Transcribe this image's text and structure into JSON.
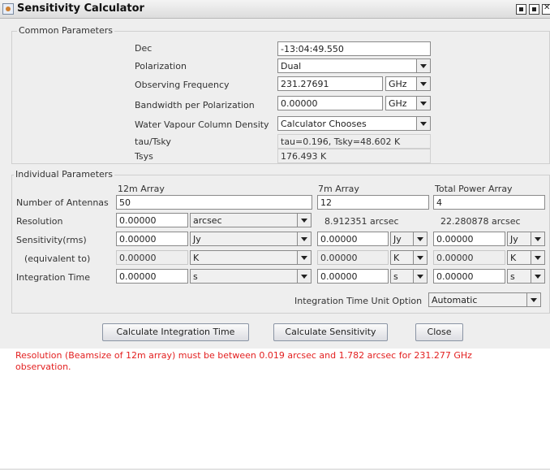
{
  "window": {
    "title": "Sensitivity Calculator",
    "icon": "java-app-icon",
    "controls": [
      "minimize-icon",
      "maximize-icon",
      "close-icon"
    ]
  },
  "common": {
    "group_title": "Common Parameters",
    "dec": {
      "label": "Dec",
      "value": "-13:04:49.550"
    },
    "polarization": {
      "label": "Polarization",
      "value": "Dual"
    },
    "frequency": {
      "label": "Observing Frequency",
      "value": "231.27691",
      "unit": "GHz"
    },
    "bandwidth": {
      "label": "Bandwidth per Polarization",
      "value": "0.00000",
      "unit": "GHz"
    },
    "water": {
      "label": "Water Vapour Column Density",
      "value": "Calculator Chooses"
    },
    "tau": {
      "label": "tau/Tsky",
      "value": "tau=0.196, Tsky=48.602 K"
    },
    "tsys": {
      "label": "Tsys",
      "value": "176.493 K"
    }
  },
  "individual": {
    "group_title": "Individual Parameters",
    "columns": {
      "c12m": "12m Array",
      "c7m": "7m Array",
      "ctp": "Total Power Array"
    },
    "rows": {
      "antennas": "Number of Antennas",
      "resolution": "Resolution",
      "sensitivity": "Sensitivity(rms)",
      "equivalent": "(equivalent to)",
      "integration": "Integration Time"
    },
    "antennas": {
      "c12m": "50",
      "c7m": "12",
      "ctp": "4"
    },
    "resolution": {
      "c12m_value": "0.00000",
      "c12m_unit": "arcsec",
      "c7m": "8.912351 arcsec",
      "ctp": "22.280878 arcsec"
    },
    "sensitivity": {
      "c12m_value": "0.00000",
      "c12m_unit": "Jy",
      "c7m_value": "0.00000",
      "c7m_unit": "Jy",
      "ctp_value": "0.00000",
      "ctp_unit": "Jy"
    },
    "equivalent": {
      "c12m_value": "0.00000",
      "c12m_unit": "K",
      "c7m_value": "0.00000",
      "c7m_unit": "K",
      "ctp_value": "0.00000",
      "ctp_unit": "K"
    },
    "integration": {
      "c12m_value": "0.00000",
      "c12m_unit": "s",
      "c7m_value": "0.00000",
      "c7m_unit": "s",
      "ctp_value": "0.00000",
      "ctp_unit": "s"
    },
    "time_unit_option": {
      "label": "Integration Time Unit Option",
      "value": "Automatic"
    }
  },
  "buttons": {
    "calc_time": "Calculate Integration Time",
    "calc_sens": "Calculate Sensitivity",
    "close": "Close"
  },
  "message": "Resolution (Beamsize of 12m array) must be between 0.019 arcsec and 1.782 arcsec for 231.277 GHz observation.",
  "colors": {
    "error_text": "#e32020",
    "panel_bg": "#eeeeee"
  }
}
